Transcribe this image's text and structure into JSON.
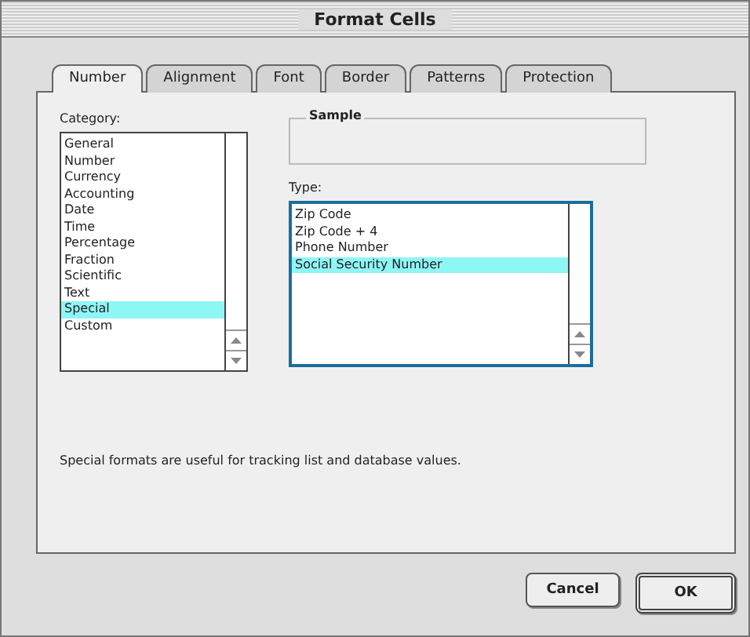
{
  "window": {
    "title": "Format Cells"
  },
  "tabs": [
    {
      "label": "Number",
      "selected": true
    },
    {
      "label": "Alignment",
      "selected": false
    },
    {
      "label": "Font",
      "selected": false
    },
    {
      "label": "Border",
      "selected": false
    },
    {
      "label": "Patterns",
      "selected": false
    },
    {
      "label": "Protection",
      "selected": false
    }
  ],
  "category": {
    "label": "Category:",
    "items": [
      {
        "label": "General",
        "selected": false
      },
      {
        "label": "Number",
        "selected": false
      },
      {
        "label": "Currency",
        "selected": false
      },
      {
        "label": "Accounting",
        "selected": false
      },
      {
        "label": "Date",
        "selected": false
      },
      {
        "label": "Time",
        "selected": false
      },
      {
        "label": "Percentage",
        "selected": false
      },
      {
        "label": "Fraction",
        "selected": false
      },
      {
        "label": "Scientific",
        "selected": false
      },
      {
        "label": "Text",
        "selected": false
      },
      {
        "label": "Special",
        "selected": true
      },
      {
        "label": "Custom",
        "selected": false
      }
    ]
  },
  "sample": {
    "label": "Sample"
  },
  "type": {
    "label": "Type:",
    "items": [
      {
        "label": "Zip Code",
        "selected": false
      },
      {
        "label": "Zip Code + 4",
        "selected": false
      },
      {
        "label": "Phone Number",
        "selected": false
      },
      {
        "label": "Social Security Number",
        "selected": true
      }
    ]
  },
  "description": "Special formats are useful for tracking list and database values.",
  "buttons": [
    {
      "label": "Cancel",
      "default": false
    },
    {
      "label": "OK",
      "default": true
    }
  ]
}
